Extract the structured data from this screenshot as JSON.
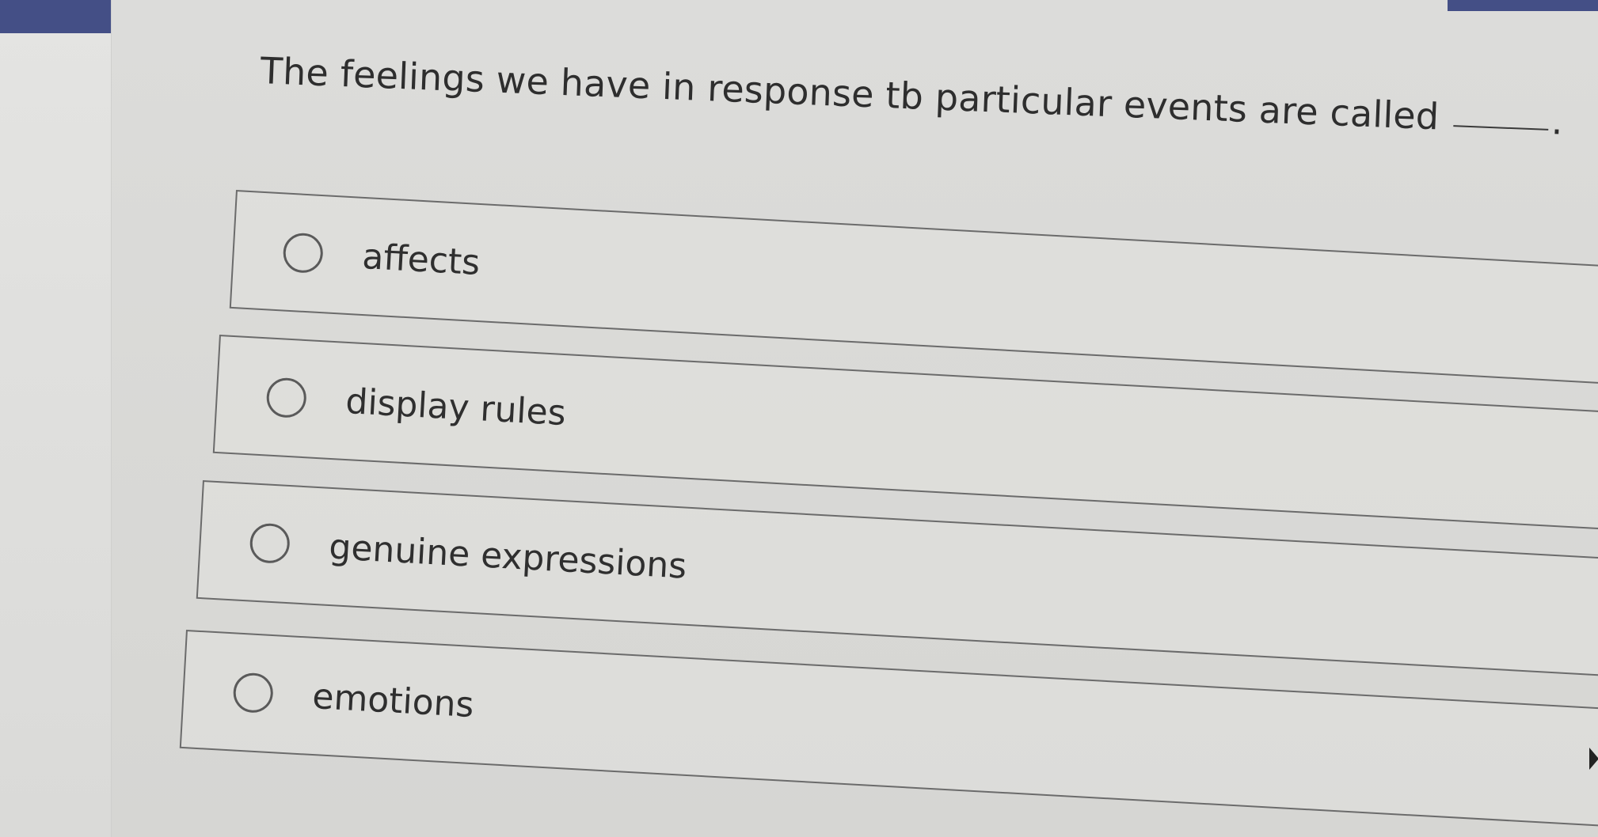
{
  "question": {
    "text": "The feelings we have in response tb particular events are called",
    "period": "."
  },
  "options": [
    {
      "label": "affects"
    },
    {
      "label": "display rules"
    },
    {
      "label": "genuine expressions"
    },
    {
      "label": "emotions"
    }
  ],
  "colors": {
    "accent_bar": "#444f86",
    "page_background": "#dcdcda",
    "option_border": "#6b6b6b",
    "text": "#2e2e2e"
  },
  "icons": {
    "radio": "radio-circle-unchecked"
  }
}
